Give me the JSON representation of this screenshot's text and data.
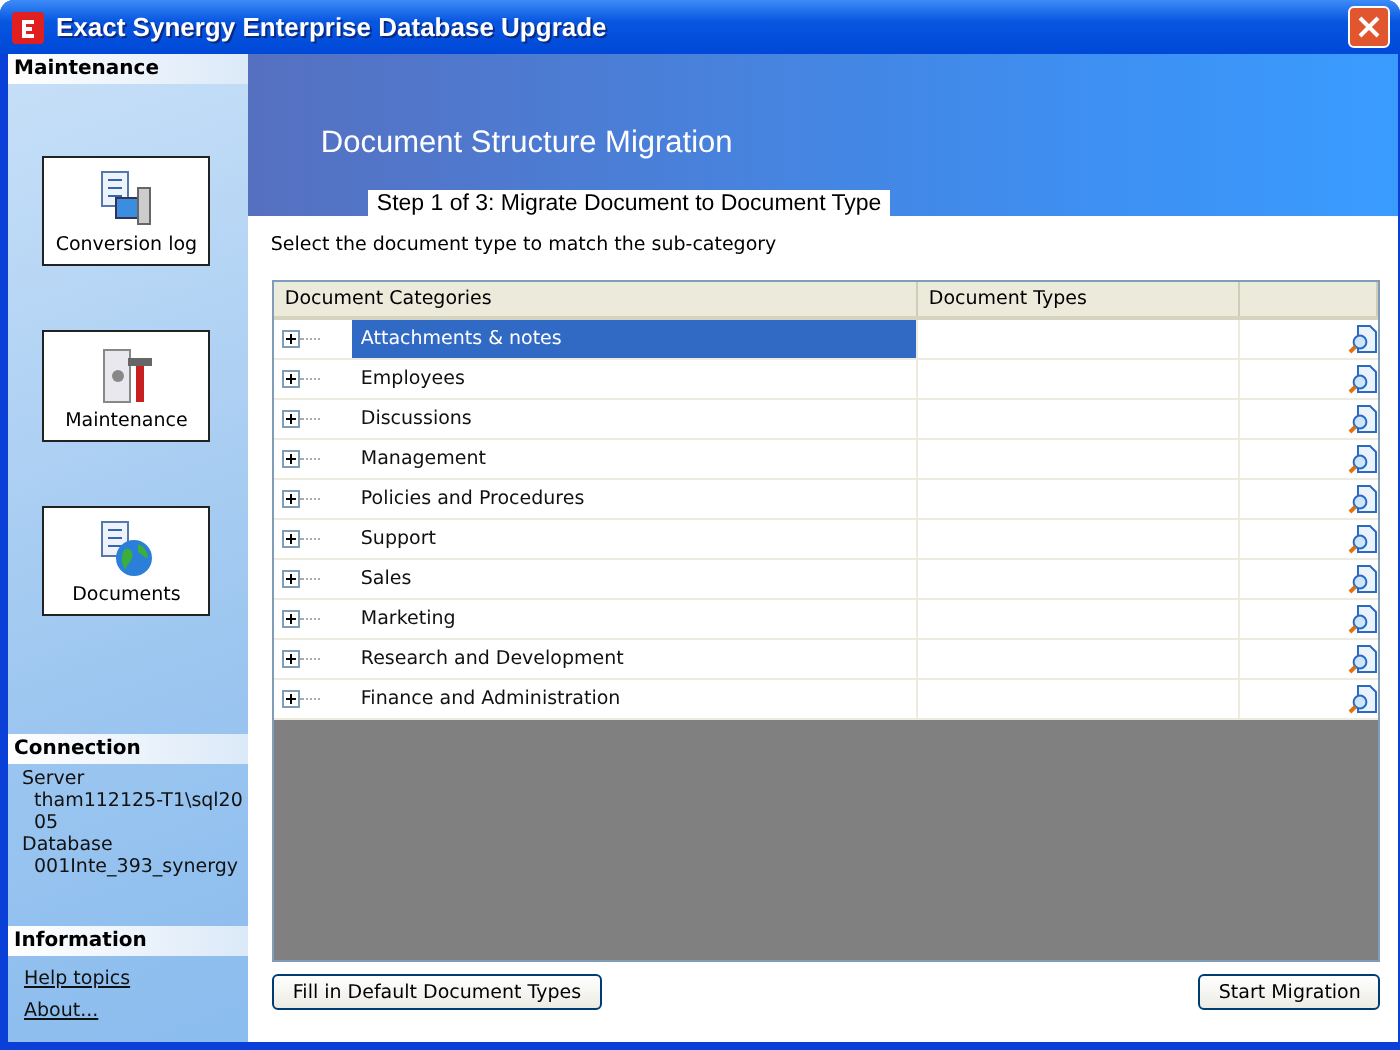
{
  "window": {
    "title": "Exact Synergy Enterprise Database Upgrade"
  },
  "sidebar": {
    "section_title": "Maintenance",
    "tiles": [
      {
        "label": "Conversion log",
        "kind": "log"
      },
      {
        "label": "Maintenance",
        "kind": "tools"
      },
      {
        "label": "Documents",
        "kind": "globe"
      }
    ],
    "connection": {
      "title": "Connection",
      "fields": [
        {
          "label": "Server",
          "value": "tham112125-T1\\sql20\n05"
        },
        {
          "label": "Database",
          "value": "001Inte_393_synergy"
        }
      ]
    },
    "information": {
      "title": "Information",
      "links": [
        "Help topics",
        "About..."
      ]
    }
  },
  "header": {
    "title": "Document Structure Migration",
    "step": "Step 1 of 3: Migrate Document to Document Type"
  },
  "instruction": "Select the document type to match the sub-category",
  "table": {
    "columns": [
      "Document Categories",
      "Document Types"
    ],
    "rows": [
      {
        "category": "Attachments & notes",
        "selected": true,
        "expanded": false
      },
      {
        "category": "Employees",
        "selected": false,
        "expanded": false
      },
      {
        "category": "Discussions",
        "selected": false,
        "expanded": false
      },
      {
        "category": "Management",
        "selected": false,
        "expanded": false
      },
      {
        "category": "Policies and Procedures",
        "selected": false,
        "expanded": false
      },
      {
        "category": "Support",
        "selected": false,
        "expanded": false
      },
      {
        "category": "Sales",
        "selected": false,
        "expanded": false
      },
      {
        "category": "Marketing",
        "selected": false,
        "expanded": false
      },
      {
        "category": "Research and Development",
        "selected": false,
        "expanded": false
      },
      {
        "category": "Finance and Administration",
        "selected": false,
        "expanded": false
      }
    ]
  },
  "buttons": [
    "Fill in Default Document Types",
    "Start Migration"
  ]
}
